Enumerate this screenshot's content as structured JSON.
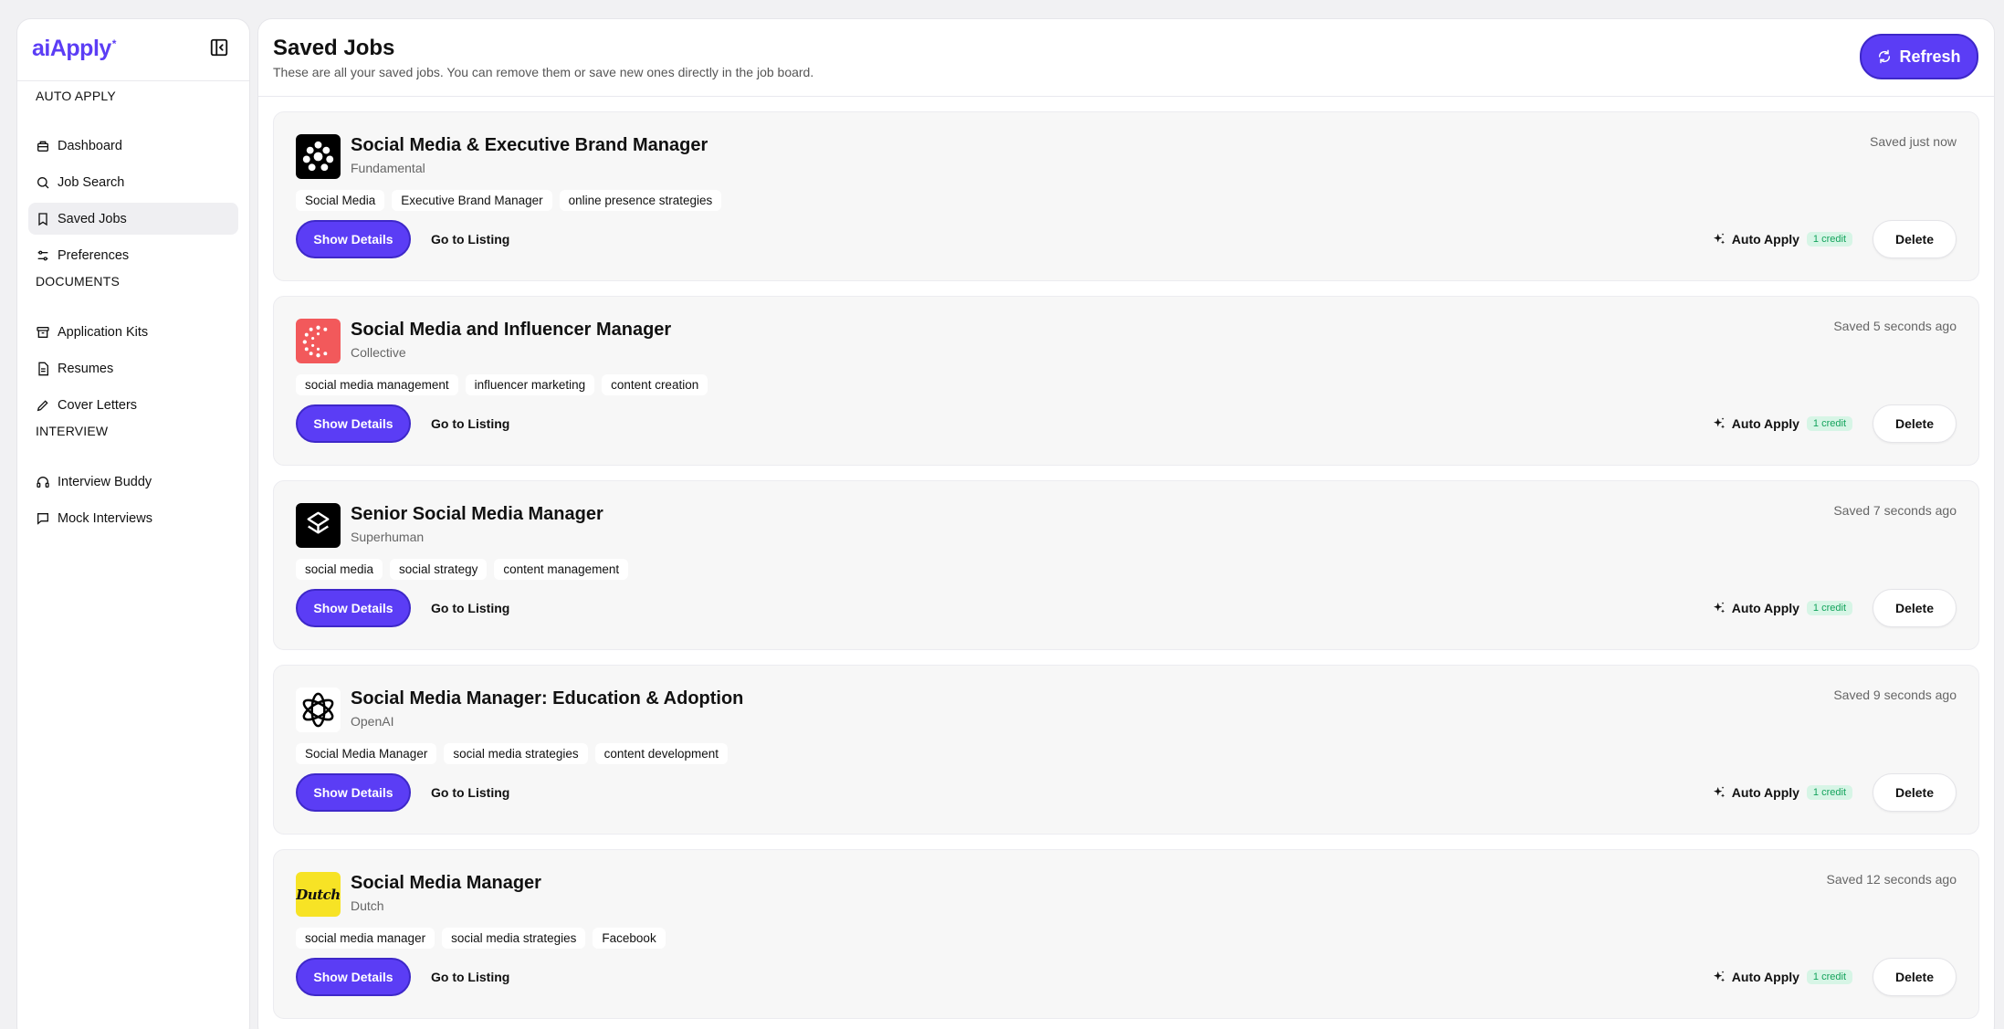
{
  "brand": {
    "name": "aiApply",
    "mark": "*",
    "accent": "#5b3df5"
  },
  "sidebar": {
    "sections": [
      {
        "title": "AUTO APPLY",
        "items": [
          {
            "label": "Dashboard",
            "icon": "dashboard-icon"
          },
          {
            "label": "Job Search",
            "icon": "search-icon"
          },
          {
            "label": "Saved Jobs",
            "icon": "bookmark-icon",
            "active": true
          },
          {
            "label": "Preferences",
            "icon": "sliders-icon"
          }
        ]
      },
      {
        "title": "DOCUMENTS",
        "items": [
          {
            "label": "Application Kits",
            "icon": "archive-icon"
          },
          {
            "label": "Resumes",
            "icon": "document-icon"
          },
          {
            "label": "Cover Letters",
            "icon": "pencil-icon"
          }
        ]
      },
      {
        "title": "INTERVIEW",
        "items": [
          {
            "label": "Interview Buddy",
            "icon": "headphones-icon"
          },
          {
            "label": "Mock Interviews",
            "icon": "chat-icon"
          }
        ]
      }
    ]
  },
  "header": {
    "title": "Saved Jobs",
    "subtitle": "These are all your saved jobs. You can remove them or save new ones directly in the job board.",
    "refresh_label": "Refresh"
  },
  "actions": {
    "show_details": "Show Details",
    "go_to_listing": "Go to Listing",
    "auto_apply": "Auto Apply",
    "credit": "1 credit",
    "delete": "Delete"
  },
  "jobs": [
    {
      "title": "Social Media & Executive Brand Manager",
      "company": "Fundamental",
      "saved": "Saved  just now",
      "tags": [
        "Social Media",
        "Executive Brand Manager",
        "online presence strategies"
      ],
      "logo": "fundamental-logo"
    },
    {
      "title": "Social Media and Influencer Manager",
      "company": "Collective",
      "saved": "Saved  5 seconds ago",
      "tags": [
        "social media management",
        "influencer marketing",
        "content creation"
      ],
      "logo": "collective-logo"
    },
    {
      "title": "Senior Social Media Manager",
      "company": "Superhuman",
      "saved": "Saved  7 seconds ago",
      "tags": [
        "social media",
        "social strategy",
        "content management"
      ],
      "logo": "superhuman-logo"
    },
    {
      "title": "Social Media Manager: Education & Adoption",
      "company": "OpenAI",
      "saved": "Saved  9 seconds ago",
      "tags": [
        "Social Media Manager",
        "social media strategies",
        "content development"
      ],
      "logo": "openai-logo"
    },
    {
      "title": "Social Media Manager",
      "company": "Dutch",
      "saved": "Saved  12 seconds ago",
      "tags": [
        "social media manager",
        "social media strategies",
        "Facebook"
      ],
      "logo": "dutch-logo",
      "logo_text": "Dutch"
    }
  ]
}
